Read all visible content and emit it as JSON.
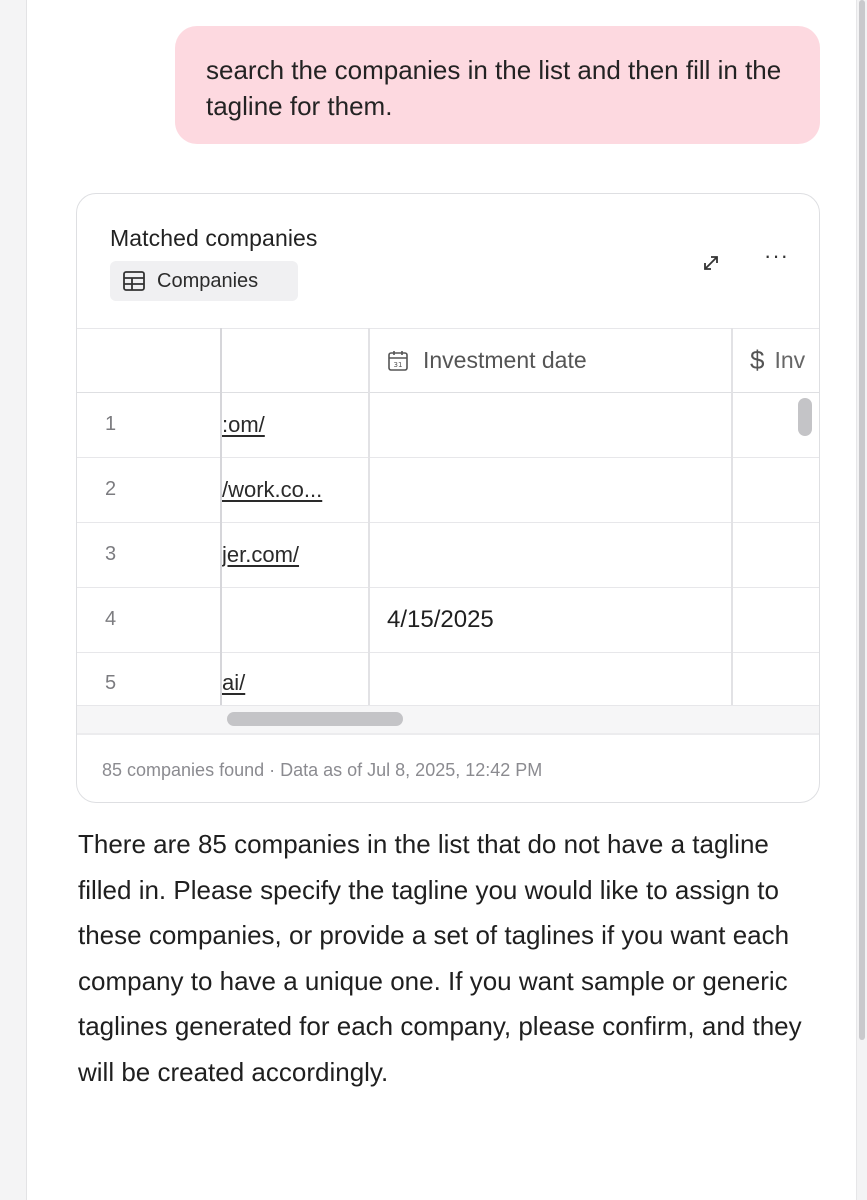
{
  "user_message": "search the companies in the list and then fill in the tagline for them.",
  "card": {
    "title": "Matched companies",
    "tag_label": "Companies",
    "tag_icon": "table-icon",
    "actions": [
      "expand-icon",
      "more-icon"
    ],
    "columns": [
      {
        "label": ""
      },
      {
        "label": ""
      },
      {
        "label": "Investment date",
        "icon": "calendar-icon"
      },
      {
        "label": "Inv",
        "icon": "dollar-icon"
      }
    ],
    "rows": [
      {
        "num": "1",
        "url": ":om/",
        "date": ""
      },
      {
        "num": "2",
        "url": "/work.co...",
        "date": ""
      },
      {
        "num": "3",
        "url": "jer.com/",
        "date": ""
      },
      {
        "num": "4",
        "url": "",
        "date": "4/15/2025"
      },
      {
        "num": "5",
        "url": "ai/",
        "date": ""
      }
    ],
    "footer": "85 companies found · Data as of Jul 8, 2025, 12:42 PM"
  },
  "assistant_message": "There are 85 companies in the list that do not have a tagline filled in. Please specify the tagline you would like to assign to these companies, or provide a set of taglines if you want each company to have a unique one. If you want sample or generic taglines generated for each company, please confirm, and they will be created accordingly."
}
